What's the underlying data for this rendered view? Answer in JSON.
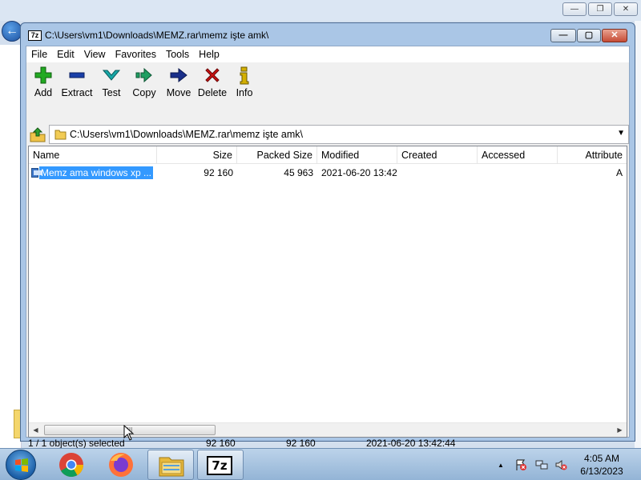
{
  "window": {
    "title": "C:\\Users\\vm1\\Downloads\\MEMZ.rar\\memz işte amk\\",
    "app_icon": "7z",
    "controls": {
      "minimize": "—",
      "maximize": "▢",
      "close": "✕"
    }
  },
  "menu": [
    "File",
    "Edit",
    "View",
    "Favorites",
    "Tools",
    "Help"
  ],
  "toolbar": {
    "add_label": "Add",
    "extract_label": "Extract",
    "test_label": "Test",
    "copy_label": "Copy",
    "move_label": "Move",
    "delete_label": "Delete",
    "info_label": "Info"
  },
  "address": {
    "path": "C:\\Users\\vm1\\Downloads\\MEMZ.rar\\memz işte amk\\",
    "dropdown_icon": "chevron-down-icon"
  },
  "columns": [
    "Name",
    "Size",
    "Packed Size",
    "Modified",
    "Created",
    "Accessed",
    "Attribute"
  ],
  "rows": [
    {
      "name": "Memz ama windows xp ...",
      "size": "92 160",
      "packed_size": "45 963",
      "modified": "2021-06-20 13:42",
      "created": "",
      "accessed": "",
      "attributes": "A"
    }
  ],
  "scrollbar": {
    "left": "◀",
    "right": "▶",
    "grip": "III"
  },
  "status": {
    "selection": "1 / 1 object(s) selected",
    "size": "92 160",
    "packed_size": "92 160",
    "modified": "2021-06-20 13:42:44"
  },
  "taskbar": {
    "apps": [
      "chrome-icon",
      "firefox-icon",
      "file-explorer-icon",
      "7zip-icon"
    ],
    "seven_zip_label": "7z",
    "tray_arrow": "▲",
    "time": "4:05 AM",
    "date": "6/13/2023"
  },
  "background_window": {
    "controls": {
      "minimize": "—",
      "maximize": "❐",
      "close": "✕"
    }
  },
  "colors": {
    "selection": "#3399ff",
    "add": "#22aa22",
    "extract": "#1a3fa8",
    "test": "#18a7a7",
    "copy": "#1f9f62",
    "move": "#1a2f8a",
    "delete": "#cc1111",
    "info": "#d4b000"
  }
}
